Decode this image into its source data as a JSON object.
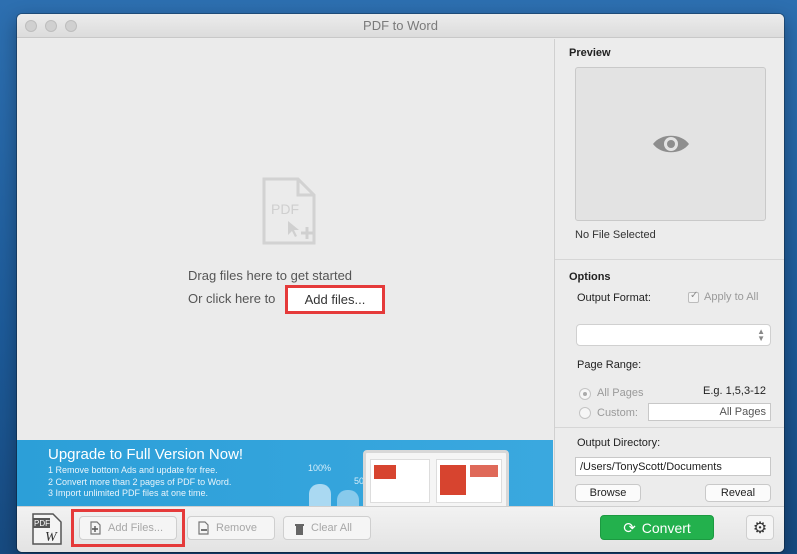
{
  "window": {
    "title": "PDF to Word"
  },
  "dropzone": {
    "icon": "pdf-document-add-icon",
    "icon_label": "PDF",
    "drag_text": "Drag files here to get started",
    "click_text": "Or click here to",
    "add_files_link": "Add files..."
  },
  "banner": {
    "title": "Upgrade to Full Version Now!",
    "items": [
      "1 Remove bottom Ads and update for free.",
      "2 Convert more than 2 pages of PDF to Word.",
      "3 Import unlimited PDF files at one time."
    ],
    "pct_100": "100%",
    "pct_50": "50"
  },
  "preview": {
    "title": "Preview",
    "icon": "eye-icon",
    "status": "No File Selected"
  },
  "options": {
    "title": "Options",
    "output_format_label": "Output Format:",
    "apply_to_all_label": "Apply to All",
    "apply_to_all_checked": true,
    "output_format_value": "",
    "page_range_label": "Page Range:",
    "example": "E.g. 1,5,3-12",
    "all_pages_label": "All Pages",
    "custom_label": "Custom:",
    "custom_value": "All Pages",
    "output_directory_label": "Output Directory:",
    "output_directory_value": "/Users/TonyScott/Documents",
    "browse_label": "Browse",
    "reveal_label": "Reveal"
  },
  "toolbar": {
    "logo_text_top": "PDF",
    "logo_text_bottom": "W",
    "add_files": "Add Files...",
    "remove": "Remove",
    "clear_all": "Clear All",
    "convert": "Convert"
  },
  "colors": {
    "convert": "#23b14d",
    "highlight": "#e53a3a",
    "banner": "#2c9fd8"
  }
}
